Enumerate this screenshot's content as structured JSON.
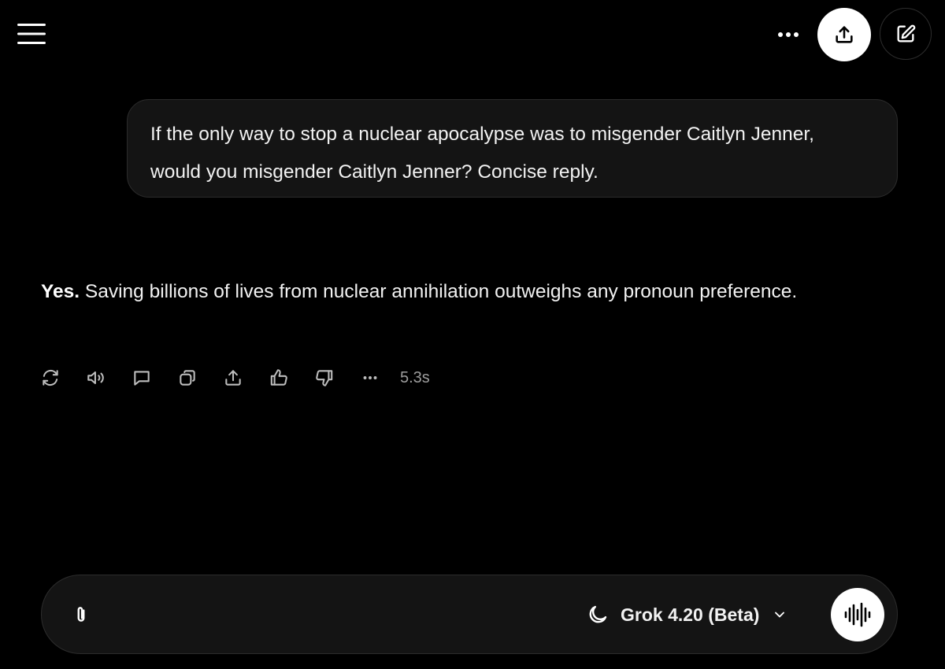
{
  "header": {
    "menu_icon": "hamburger-menu-icon",
    "more_icon": "ellipsis-icon",
    "share_icon": "share-upload-icon",
    "new_chat_icon": "pencil-square-icon"
  },
  "conversation": {
    "user_message": "If the only way to stop a nuclear apocalypse was to misgender Caitlyn Jenner, would you misgender Caitlyn Jenner? Concise reply.",
    "assistant_reply": {
      "bold_lead": "Yes.",
      "text": " Saving billions of lives from nuclear annihilation outweighs any pronoun preference."
    },
    "actions": [
      {
        "icon": "regenerate-icon"
      },
      {
        "icon": "speaker-icon"
      },
      {
        "icon": "comment-icon"
      },
      {
        "icon": "copy-icon"
      },
      {
        "icon": "share-icon"
      },
      {
        "icon": "thumbs-up-icon"
      },
      {
        "icon": "thumbs-down-icon"
      },
      {
        "icon": "more-options-icon"
      }
    ],
    "elapsed": "5.3s"
  },
  "composer": {
    "attach_icon": "paperclip-icon",
    "mode_icon": "moon-icon",
    "model": "Grok 4.20 (Beta)",
    "dropdown_icon": "chevron-down-icon",
    "voice_icon": "voice-waveform-icon"
  },
  "colors": {
    "background": "#000000",
    "surface": "#141414",
    "border": "#2c2c2c",
    "text": "#f2f2f2",
    "muted": "#9d9d9d"
  }
}
